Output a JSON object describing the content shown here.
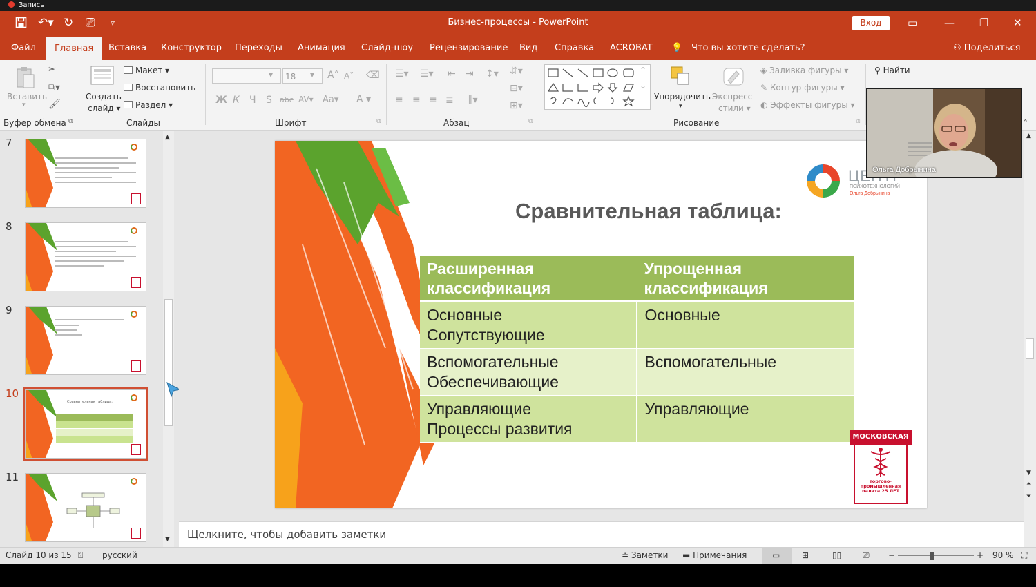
{
  "recording": {
    "label": "Запись"
  },
  "titlebar": {
    "title": "Бизнес-процессы  -  PowerPoint",
    "signin_label": "Вход",
    "accent": "#c43e1c"
  },
  "tabs": [
    "Файл",
    "Главная",
    "Вставка",
    "Конструктор",
    "Переходы",
    "Анимация",
    "Слайд-шоу",
    "Рецензирование",
    "Вид",
    "Справка",
    "ACROBAT"
  ],
  "tell_me": "Что вы хотите сделать?",
  "share_label": "Поделиться",
  "ribbon": {
    "clipboard": {
      "paste": "Вставить",
      "label": "Буфер обмена"
    },
    "slides": {
      "new_slide_line1": "Создать",
      "new_slide_line2": "слайд",
      "layout": "Макет",
      "reset": "Восстановить",
      "section": "Раздел",
      "label": "Слайды"
    },
    "font": {
      "size": "18",
      "label": "Шрифт"
    },
    "paragraph": {
      "label": "Абзац"
    },
    "drawing": {
      "arrange": "Упорядочить",
      "quick_styles_line1": "Экспресс-",
      "quick_styles_line2": "стили",
      "fill": "Заливка фигуры",
      "outline": "Контур фигуры",
      "effects": "Эффекты фигуры",
      "label": "Рисование"
    },
    "editing": {
      "find": "Найти"
    }
  },
  "thumbnails": [
    {
      "number": "7",
      "title": ""
    },
    {
      "number": "8",
      "title": ""
    },
    {
      "number": "9",
      "title": ""
    },
    {
      "number": "10",
      "title": "Сравнительная таблица:"
    },
    {
      "number": "11",
      "title": ""
    }
  ],
  "slide": {
    "title": "Сравнительная таблица:",
    "logo_text": "ЦЕНТР",
    "logo_sub": "ПСИХОТЕХНОЛОГИЙ",
    "logo_author": "Ольга Добрынина",
    "badge_top": "МОСКОВСКАЯ",
    "badge_bottom": "торгово-промышленная палата 25 ЛЕТ",
    "table": {
      "headers": [
        "Расширенная классификация",
        "Упрощенная классификация"
      ],
      "rows": [
        {
          "left_1": "Основные",
          "left_2": "Сопутствующие",
          "right": "Основные"
        },
        {
          "left_1": "Вспомогательные",
          "left_2": "Обеспечивающие",
          "right": "Вспомогательные"
        },
        {
          "left_1": "Управляющие",
          "left_2": "Процессы развития",
          "right": "Управляющие"
        }
      ]
    }
  },
  "notes_placeholder": "Щелкните, чтобы добавить заметки",
  "status": {
    "slide_info": "Слайд 10 из 15",
    "language": "русский",
    "notes": "Заметки",
    "comments": "Примечания",
    "zoom": "90 %"
  },
  "webcam": {
    "name": "Ольга Добрынина"
  },
  "colors": {
    "table_header": "#9bbb59",
    "table_odd": "#cfe39d",
    "table_even": "#e6f1c9",
    "brush_orange": "#f26522",
    "brush_green": "#5ba32d"
  }
}
